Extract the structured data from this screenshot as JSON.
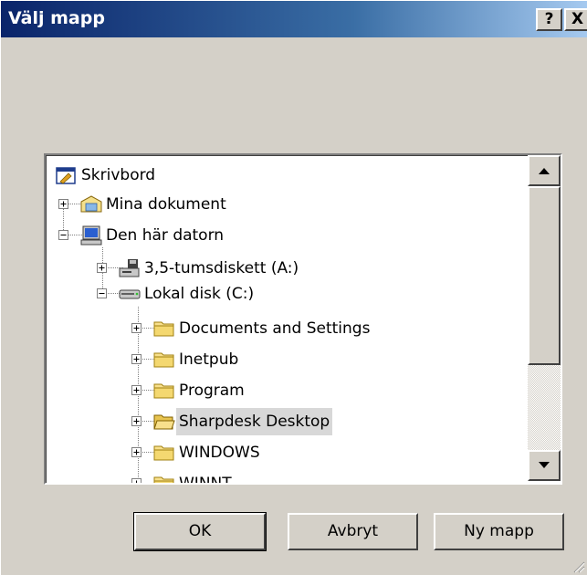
{
  "window": {
    "title": "Välj mapp",
    "help_glyph": "?",
    "close_glyph": "X"
  },
  "tree": {
    "items": [
      {
        "label": "Skrivbord",
        "icon": "desktop-icon"
      },
      {
        "label": "Mina dokument",
        "icon": "my-documents-icon",
        "expander": "+"
      },
      {
        "label": "Den här datorn",
        "icon": "my-computer-icon",
        "expander": "-"
      },
      {
        "label": "3,5-tumsdiskett (A:)",
        "icon": "floppy-drive-icon",
        "expander": "+"
      },
      {
        "label": "Lokal disk (C:)",
        "icon": "hard-disk-icon",
        "expander": "-"
      },
      {
        "label": "Documents and Settings",
        "icon": "folder-icon",
        "expander": "+"
      },
      {
        "label": "Inetpub",
        "icon": "folder-icon",
        "expander": "+"
      },
      {
        "label": "Program",
        "icon": "folder-icon",
        "expander": "+"
      },
      {
        "label": "Sharpdesk Desktop",
        "icon": "open-folder-icon",
        "expander": "+",
        "selected": true
      },
      {
        "label": "WINDOWS",
        "icon": "folder-icon",
        "expander": "+"
      },
      {
        "label": "WINNT",
        "icon": "folder-icon",
        "expander": "+"
      }
    ]
  },
  "buttons": {
    "ok": "OK",
    "cancel": "Avbryt",
    "new_folder": "Ny mapp"
  }
}
